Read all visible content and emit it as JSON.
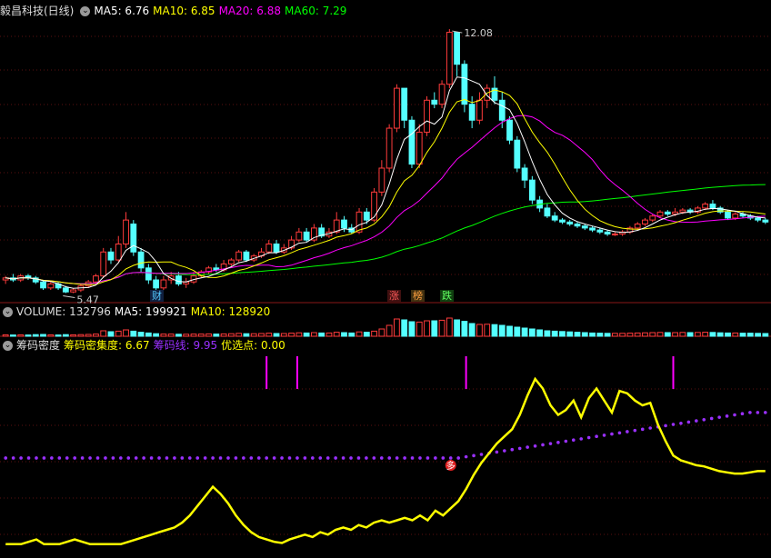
{
  "main": {
    "title": "毅昌科技(日线)",
    "ma5_label": "MA5: 6.76",
    "ma10_label": "MA10: 6.85",
    "ma20_label": "MA20: 6.88",
    "ma60_label": "MA60: 7.29",
    "high_label": "12.08",
    "low_label": "5.47",
    "tags": {
      "cai": "财",
      "zhang": "涨",
      "bang": "榜",
      "die": "跌"
    }
  },
  "volume": {
    "label": "VOLUME: 132796",
    "ma5": "MA5: 199921",
    "ma10": "MA10: 128920"
  },
  "chip": {
    "title": "筹码密度",
    "density": "筹码密集度: 6.67",
    "line": "筹码线: 9.95",
    "pick": "优选点: 0.00",
    "marker": "多"
  },
  "colors": {
    "up": "#ff3b3b",
    "down": "#54ffff",
    "ma5": "#ffffff",
    "ma10": "#ffff00",
    "ma20": "#ff00ff",
    "ma60": "#00ff00",
    "density": "#ffff00",
    "line": "#9a30ff",
    "pick": "#ff00ff"
  },
  "chart_data": [
    {
      "type": "candlestick",
      "title": "毅昌科技(日线)",
      "annotations": [
        {
          "text": "12.08",
          "kind": "high"
        },
        {
          "text": "5.47",
          "kind": "low"
        }
      ],
      "candles": [
        [
          5.8,
          5.85,
          5.7,
          5.9
        ],
        [
          5.85,
          5.8,
          5.75,
          5.95
        ],
        [
          5.8,
          5.9,
          5.75,
          5.95
        ],
        [
          5.9,
          5.85,
          5.8,
          5.95
        ],
        [
          5.85,
          5.75,
          5.7,
          5.9
        ],
        [
          5.75,
          5.6,
          5.55,
          5.8
        ],
        [
          5.6,
          5.7,
          5.55,
          5.75
        ],
        [
          5.7,
          5.6,
          5.55,
          5.75
        ],
        [
          5.6,
          5.5,
          5.47,
          5.65
        ],
        [
          5.5,
          5.55,
          5.47,
          5.6
        ],
        [
          5.55,
          5.65,
          5.5,
          5.7
        ],
        [
          5.65,
          5.75,
          5.6,
          5.8
        ],
        [
          5.75,
          5.9,
          5.7,
          5.95
        ],
        [
          5.9,
          6.5,
          5.85,
          6.6
        ],
        [
          6.5,
          6.3,
          6.2,
          6.6
        ],
        [
          6.3,
          6.7,
          6.25,
          6.9
        ],
        [
          6.7,
          7.3,
          6.6,
          7.5
        ],
        [
          7.2,
          6.5,
          6.4,
          7.3
        ],
        [
          6.5,
          6.1,
          6.0,
          6.6
        ],
        [
          6.1,
          5.8,
          5.7,
          6.2
        ],
        [
          5.8,
          5.6,
          5.5,
          5.9
        ],
        [
          5.6,
          5.8,
          5.55,
          5.9
        ],
        [
          5.8,
          5.9,
          5.7,
          6.0
        ],
        [
          5.9,
          5.7,
          5.65,
          6.0
        ],
        [
          5.7,
          5.75,
          5.6,
          5.85
        ],
        [
          5.75,
          5.9,
          5.7,
          6.0
        ],
        [
          5.9,
          6.0,
          5.85,
          6.05
        ],
        [
          6.0,
          6.1,
          5.95,
          6.15
        ],
        [
          6.1,
          6.05,
          6.0,
          6.2
        ],
        [
          6.05,
          6.2,
          6.0,
          6.3
        ],
        [
          6.2,
          6.3,
          6.15,
          6.35
        ],
        [
          6.3,
          6.5,
          6.25,
          6.55
        ],
        [
          6.5,
          6.3,
          6.25,
          6.55
        ],
        [
          6.3,
          6.4,
          6.25,
          6.45
        ],
        [
          6.4,
          6.5,
          6.35,
          6.6
        ],
        [
          6.5,
          6.7,
          6.45,
          6.8
        ],
        [
          6.7,
          6.5,
          6.45,
          6.8
        ],
        [
          6.5,
          6.6,
          6.45,
          6.7
        ],
        [
          6.6,
          6.8,
          6.55,
          6.9
        ],
        [
          6.8,
          7.0,
          6.75,
          7.1
        ],
        [
          7.0,
          6.8,
          6.75,
          7.1
        ],
        [
          6.8,
          7.1,
          6.75,
          7.2
        ],
        [
          7.1,
          6.9,
          6.85,
          7.2
        ],
        [
          6.9,
          7.0,
          6.85,
          7.1
        ],
        [
          7.0,
          7.3,
          6.95,
          7.5
        ],
        [
          7.3,
          7.1,
          7.0,
          7.4
        ],
        [
          7.1,
          7.0,
          6.95,
          7.2
        ],
        [
          7.0,
          7.5,
          6.95,
          7.6
        ],
        [
          7.5,
          7.3,
          7.2,
          7.6
        ],
        [
          7.3,
          8.0,
          7.25,
          8.1
        ],
        [
          8.0,
          8.6,
          7.9,
          8.8
        ],
        [
          8.6,
          9.6,
          8.5,
          9.7
        ],
        [
          9.6,
          10.6,
          9.5,
          10.7
        ],
        [
          10.6,
          9.8,
          9.6,
          10.6
        ],
        [
          9.8,
          8.7,
          8.6,
          9.9
        ],
        [
          8.7,
          9.5,
          8.6,
          9.7
        ],
        [
          9.5,
          10.3,
          9.4,
          10.4
        ],
        [
          10.3,
          10.2,
          10.1,
          10.5
        ],
        [
          10.2,
          10.7,
          10.1,
          10.8
        ],
        [
          10.7,
          12.0,
          10.6,
          12.08
        ],
        [
          12.0,
          11.2,
          10.9,
          12.0
        ],
        [
          11.2,
          10.2,
          10.0,
          11.3
        ],
        [
          10.2,
          9.8,
          9.6,
          10.4
        ],
        [
          9.8,
          10.3,
          9.7,
          10.5
        ],
        [
          10.3,
          10.6,
          10.1,
          10.7
        ],
        [
          10.6,
          10.3,
          10.2,
          10.9
        ],
        [
          10.3,
          9.8,
          9.6,
          10.5
        ],
        [
          9.8,
          9.3,
          9.2,
          9.9
        ],
        [
          9.3,
          8.6,
          8.5,
          9.4
        ],
        [
          8.6,
          8.3,
          8.1,
          8.7
        ],
        [
          8.3,
          7.8,
          7.7,
          8.4
        ],
        [
          7.8,
          7.6,
          7.5,
          7.9
        ],
        [
          7.6,
          7.4,
          7.35,
          7.7
        ],
        [
          7.4,
          7.3,
          7.25,
          7.5
        ],
        [
          7.3,
          7.25,
          7.2,
          7.35
        ],
        [
          7.25,
          7.2,
          7.15,
          7.3
        ],
        [
          7.2,
          7.15,
          7.1,
          7.25
        ],
        [
          7.15,
          7.1,
          7.05,
          7.2
        ],
        [
          7.1,
          7.05,
          7.0,
          7.15
        ],
        [
          7.05,
          7.0,
          6.95,
          7.1
        ],
        [
          7.0,
          6.95,
          6.9,
          7.05
        ],
        [
          6.95,
          6.95,
          6.9,
          7.0
        ],
        [
          6.95,
          7.0,
          6.9,
          7.05
        ],
        [
          7.0,
          7.1,
          6.95,
          7.15
        ],
        [
          7.1,
          7.2,
          7.05,
          7.25
        ],
        [
          7.2,
          7.3,
          7.15,
          7.35
        ],
        [
          7.3,
          7.4,
          7.25,
          7.45
        ],
        [
          7.4,
          7.5,
          7.35,
          7.55
        ],
        [
          7.5,
          7.45,
          7.4,
          7.55
        ],
        [
          7.45,
          7.5,
          7.4,
          7.6
        ],
        [
          7.5,
          7.55,
          7.45,
          7.6
        ],
        [
          7.55,
          7.5,
          7.45,
          7.6
        ],
        [
          7.5,
          7.6,
          7.45,
          7.65
        ],
        [
          7.6,
          7.7,
          7.55,
          7.75
        ],
        [
          7.7,
          7.6,
          7.55,
          7.8
        ],
        [
          7.6,
          7.5,
          7.45,
          7.65
        ],
        [
          7.5,
          7.35,
          7.3,
          7.55
        ],
        [
          7.35,
          7.45,
          7.3,
          7.5
        ],
        [
          7.45,
          7.4,
          7.35,
          7.5
        ],
        [
          7.4,
          7.35,
          7.3,
          7.45
        ],
        [
          7.35,
          7.3,
          7.25,
          7.4
        ],
        [
          7.3,
          7.25,
          7.2,
          7.35
        ]
      ],
      "ylim": [
        5.3,
        12.4
      ]
    },
    {
      "type": "bar",
      "title": "VOLUME",
      "values": [
        8,
        7,
        8,
        7,
        9,
        10,
        8,
        7,
        9,
        8,
        9,
        10,
        12,
        30,
        25,
        28,
        35,
        28,
        22,
        18,
        14,
        12,
        12,
        11,
        11,
        12,
        12,
        13,
        12,
        13,
        14,
        16,
        14,
        14,
        15,
        17,
        15,
        15,
        17,
        19,
        18,
        20,
        18,
        18,
        22,
        20,
        18,
        24,
        22,
        28,
        40,
        60,
        95,
        90,
        80,
        78,
        85,
        85,
        88,
        100,
        90,
        82,
        70,
        65,
        66,
        64,
        60,
        55,
        50,
        45,
        40,
        35,
        30,
        28,
        26,
        24,
        22,
        20,
        18,
        17,
        16,
        16,
        16,
        17,
        18,
        19,
        20,
        21,
        20,
        20,
        21,
        20,
        21,
        22,
        21,
        19,
        18,
        18,
        17,
        17,
        16,
        15
      ],
      "ylim": [
        0,
        100
      ]
    },
    {
      "type": "line",
      "title": "筹码密度",
      "series": [
        {
          "name": "筹码密集度",
          "values": [
            6.0,
            6.0,
            6.0,
            6.1,
            6.2,
            6.0,
            6.0,
            6.0,
            6.1,
            6.2,
            6.1,
            6.0,
            6.0,
            6.0,
            6.0,
            6.0,
            6.1,
            6.2,
            6.3,
            6.4,
            6.5,
            6.6,
            6.7,
            6.9,
            7.2,
            7.6,
            8.0,
            8.4,
            8.1,
            7.7,
            7.2,
            6.8,
            6.5,
            6.3,
            6.2,
            6.1,
            6.05,
            6.2,
            6.3,
            6.4,
            6.3,
            6.5,
            6.4,
            6.6,
            6.7,
            6.6,
            6.8,
            6.7,
            6.9,
            7.0,
            6.9,
            7.0,
            7.1,
            7.0,
            7.2,
            7.0,
            7.4,
            7.2,
            7.5,
            7.8,
            8.3,
            8.9,
            9.4,
            9.8,
            10.2,
            10.5,
            10.8,
            11.4,
            12.2,
            12.9,
            12.5,
            11.8,
            11.4,
            11.6,
            12.0,
            11.3,
            12.1,
            12.5,
            12.0,
            11.5,
            12.4,
            12.3,
            12.0,
            11.8,
            11.9,
            11.0,
            10.3,
            9.7,
            9.5,
            9.4,
            9.3,
            9.25,
            9.15,
            9.05,
            9.0,
            8.95,
            8.95,
            9.0,
            9.05,
            9.05
          ]
        },
        {
          "name": "筹码线",
          "values": [
            9.6,
            9.6,
            9.6,
            9.6,
            9.6,
            9.6,
            9.6,
            9.6,
            9.6,
            9.6,
            9.6,
            9.6,
            9.6,
            9.6,
            9.6,
            9.6,
            9.6,
            9.6,
            9.6,
            9.6,
            9.6,
            9.6,
            9.6,
            9.6,
            9.6,
            9.6,
            9.6,
            9.6,
            9.6,
            9.6,
            9.6,
            9.6,
            9.6,
            9.6,
            9.6,
            9.6,
            9.6,
            9.6,
            9.6,
            9.6,
            9.6,
            9.6,
            9.6,
            9.6,
            9.6,
            9.6,
            9.6,
            9.6,
            9.6,
            9.6,
            9.6,
            9.6,
            9.6,
            9.6,
            9.6,
            9.6,
            9.6,
            9.6,
            9.6,
            9.6,
            9.65,
            9.7,
            9.75,
            9.8,
            9.85,
            9.9,
            9.95,
            10.0,
            10.05,
            10.1,
            10.15,
            10.2,
            10.25,
            10.3,
            10.35,
            10.4,
            10.45,
            10.5,
            10.55,
            10.6,
            10.65,
            10.7,
            10.75,
            10.8,
            10.85,
            10.9,
            10.95,
            11.0,
            11.05,
            11.1,
            11.15,
            11.2,
            11.25,
            11.3,
            11.35,
            11.4,
            11.45,
            11.5,
            11.5,
            11.5
          ]
        },
        {
          "name": "优选点",
          "values": [
            0,
            0,
            0,
            0,
            0,
            0,
            0,
            0,
            0,
            0,
            0,
            0,
            0,
            0,
            0,
            0,
            0,
            0,
            0,
            0,
            0,
            0,
            0,
            0,
            0,
            0,
            0,
            0,
            0,
            0,
            0,
            0,
            0,
            0,
            0,
            0,
            0,
            0,
            0,
            0,
            0,
            0,
            0,
            0,
            0,
            0,
            0,
            0,
            0,
            0,
            0,
            0,
            0,
            0,
            0,
            0,
            0,
            0,
            0,
            0,
            0,
            0,
            0,
            0,
            0,
            0,
            0,
            0,
            0,
            0,
            0,
            0,
            0,
            0,
            0,
            0,
            0,
            0,
            0,
            0,
            0,
            0,
            0,
            0,
            0,
            0,
            0,
            0,
            0,
            0,
            0,
            0,
            0,
            0,
            0,
            0,
            0,
            0,
            0,
            0
          ]
        }
      ],
      "signals": [
        34,
        38,
        60,
        87
      ],
      "marker": {
        "text": "多",
        "index": 58
      }
    }
  ]
}
